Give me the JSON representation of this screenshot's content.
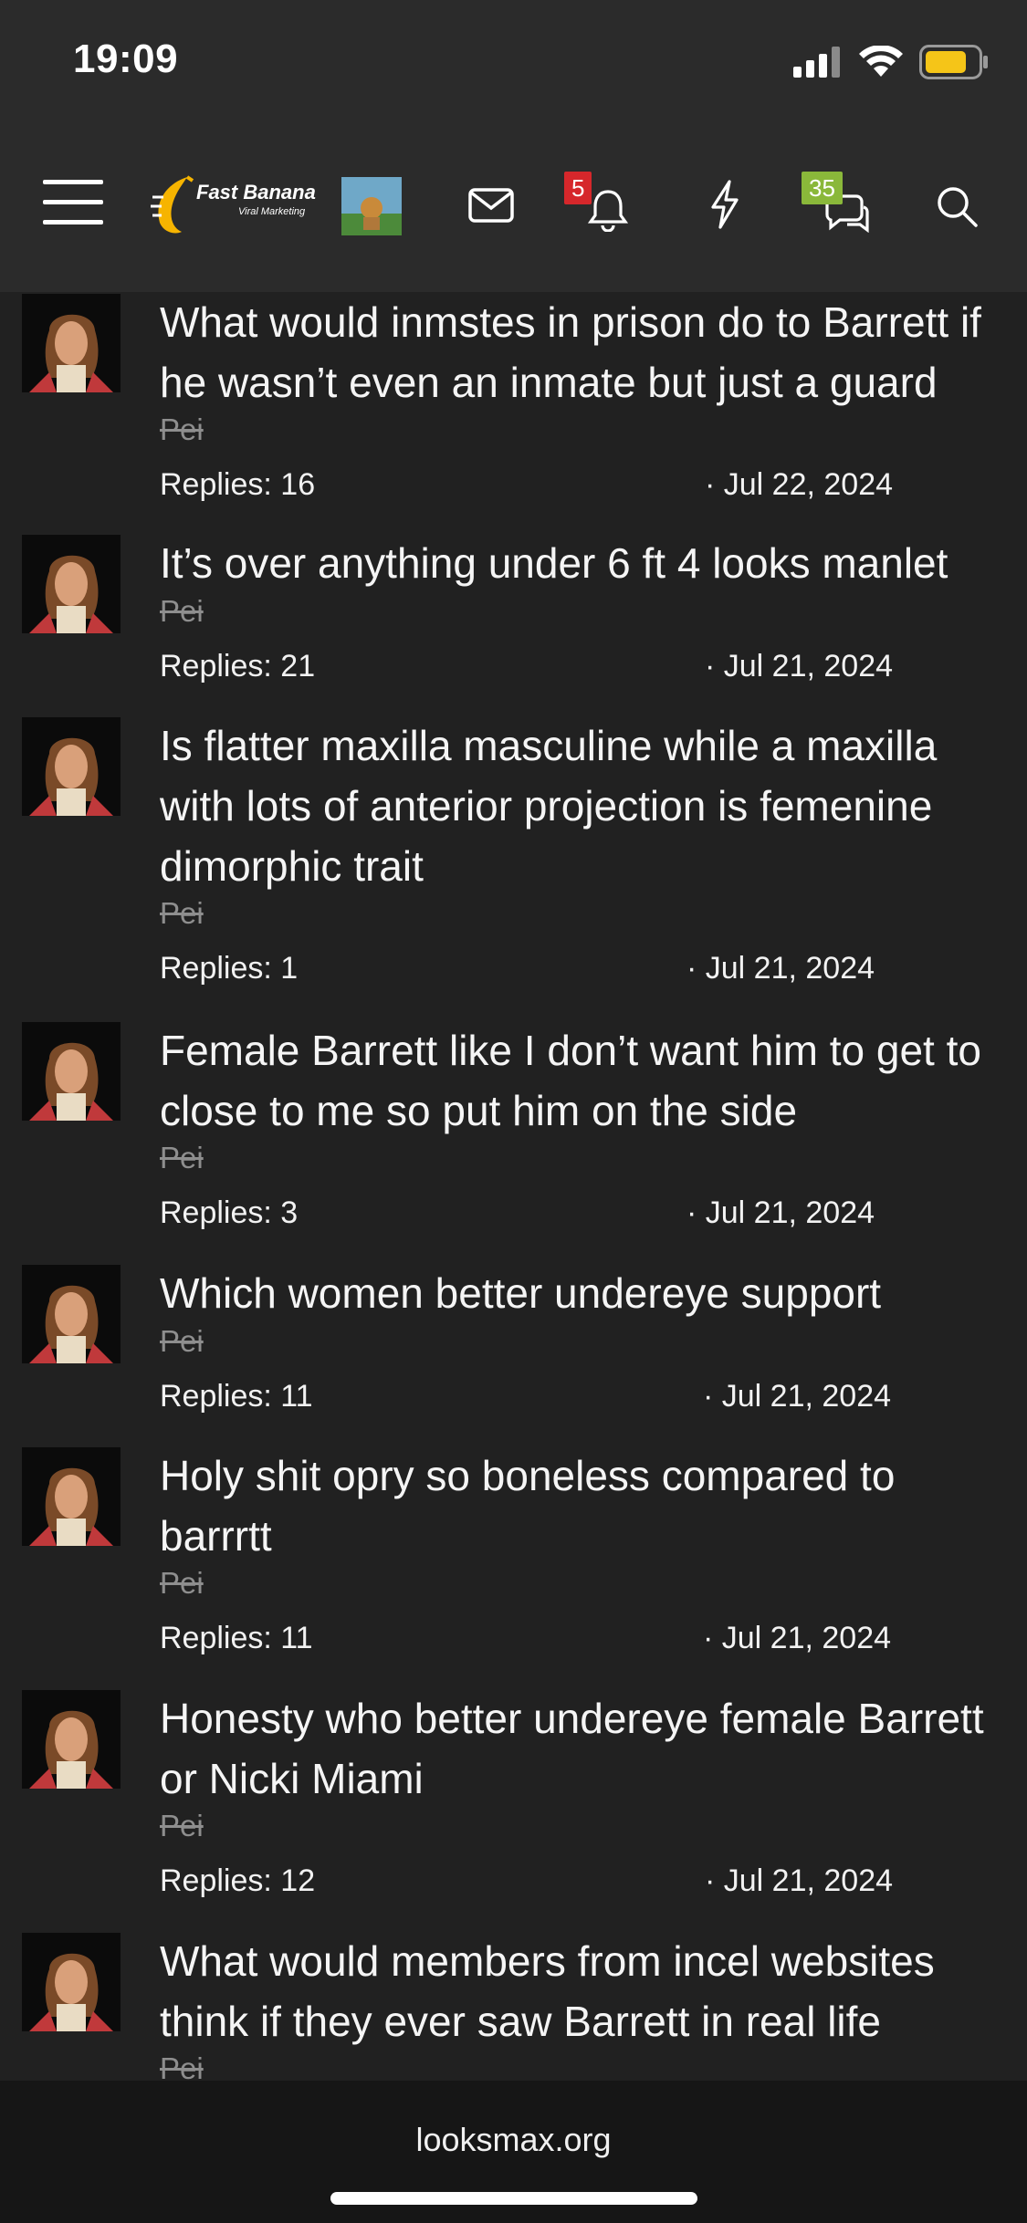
{
  "status": {
    "time": "19:09",
    "icons": [
      "signal-icon",
      "wifi-icon",
      "battery-icon"
    ],
    "battery_color": "#f5c518"
  },
  "header": {
    "logo_text": "Fast Banana",
    "logo_subtext": "Viral Marketing",
    "icons": [
      "menu-icon",
      "envelope-icon",
      "bell-icon",
      "lightning-icon",
      "chat-icon",
      "search-icon"
    ],
    "notifications_badge": "5",
    "notifications_badge_color": "#d6272b",
    "chat_badge": "35",
    "chat_badge_color": "#8ab83a"
  },
  "threads": [
    {
      "title": "What would inmstes in prison do to Barrett if he wasn’t even an inmate but just a guard",
      "author": "Pei",
      "replies": "Replies: 16",
      "date": "· Jul 22, 2024"
    },
    {
      "title": "It’s over anything under 6 ft 4 looks manlet",
      "author": "Pei",
      "replies": "Replies: 21",
      "date": "· Jul 21, 2024"
    },
    {
      "title": "Is flatter maxilla masculine while a maxilla with lots of anterior projection is femenine dimorphic trait",
      "author": "Pei",
      "replies": "Replies: 1",
      "date": "· Jul 21, 2024"
    },
    {
      "title": "Female Barrett like I don’t want him to get to close to me so put him on the side",
      "author": "Pei",
      "replies": "Replies: 3",
      "date": "· Jul 21, 2024"
    },
    {
      "title": "Which women better undereye support",
      "author": "Pei",
      "replies": "Replies: 11",
      "date": "· Jul 21, 2024"
    },
    {
      "title": "Holy shit opry so boneless compared to barrrtt",
      "author": "Pei",
      "replies": "Replies: 11",
      "date": "· Jul 21, 2024"
    },
    {
      "title": "Honesty who better undereye female Barrett or Nicki Miami",
      "author": "Pei",
      "replies": "Replies: 12",
      "date": "· Jul 21, 2024"
    },
    {
      "title": "What would members from incel websites think if they ever saw Barrett in real life",
      "author": "Pei",
      "replies": "",
      "date": ""
    }
  ],
  "footer": {
    "url": "looksmax.org"
  }
}
